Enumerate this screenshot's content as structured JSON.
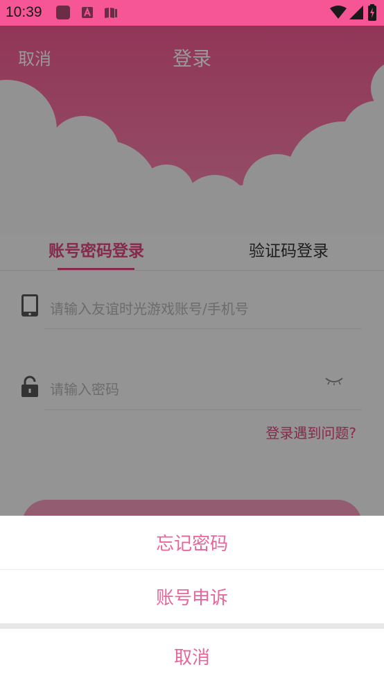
{
  "status_bar": {
    "time": "10:39",
    "icons": [
      "app-square-icon",
      "text-a-icon",
      "book-icon",
      "wifi-icon",
      "signal-icon",
      "battery-charging-icon"
    ]
  },
  "nav": {
    "cancel_label": "取消",
    "title": "登录"
  },
  "tabs": [
    {
      "label": "账号密码登录",
      "active": true
    },
    {
      "label": "验证码登录",
      "active": false
    }
  ],
  "form": {
    "account_placeholder": "请输入友谊时光游戏账号/手机号",
    "password_placeholder": "请输入密码",
    "problem_link": "登录遇到问题?"
  },
  "sheet": {
    "items": [
      "忘记密码",
      "账号申诉"
    ],
    "cancel_label": "取消"
  },
  "colors": {
    "status_bar": "#f65596",
    "accent": "#e0457f",
    "sheet_text": "#e8669a"
  }
}
